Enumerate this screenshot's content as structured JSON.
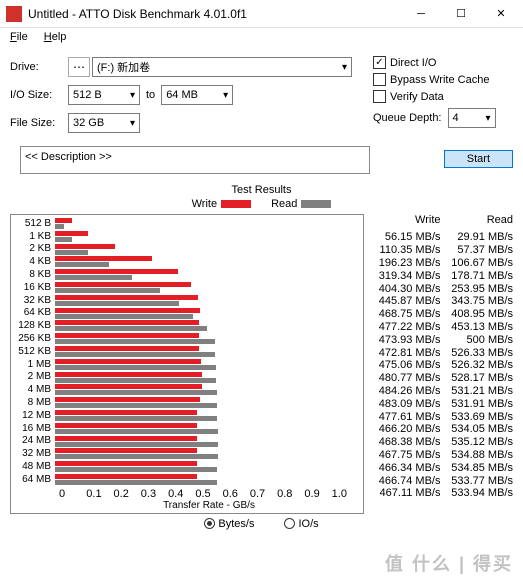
{
  "window": {
    "title": "Untitled - ATTO Disk Benchmark 4.01.0f1"
  },
  "menu": {
    "file": "File",
    "help": "Help"
  },
  "form": {
    "drive_label": "Drive:",
    "drive_value": "(F:) 新加卷",
    "io_label": "I/O Size:",
    "io_from": "512 B",
    "to": "to",
    "io_to": "64 MB",
    "fs_label": "File Size:",
    "fs_value": "32 GB",
    "direct_io": "Direct I/O",
    "bypass": "Bypass Write Cache",
    "verify": "Verify Data",
    "qd_label": "Queue Depth:",
    "qd_value": "4",
    "start": "Start",
    "description": "<< Description >>"
  },
  "results": {
    "title": "Test Results",
    "write": "Write",
    "read": "Read",
    "axis_label": "Transfer Rate - GB/s",
    "ticks": [
      "0",
      "0.1",
      "0.2",
      "0.3",
      "0.4",
      "0.5",
      "0.6",
      "0.7",
      "0.8",
      "0.9",
      "1.0"
    ],
    "bytes_s": "Bytes/s",
    "io_s": "IO/s"
  },
  "chart_data": {
    "type": "bar",
    "xlabel": "Transfer Rate - GB/s",
    "xlim": [
      0,
      1.0
    ],
    "categories": [
      "512 B",
      "1 KB",
      "2 KB",
      "4 KB",
      "8 KB",
      "16 KB",
      "32 KB",
      "64 KB",
      "128 KB",
      "256 KB",
      "512 KB",
      "1 MB",
      "2 MB",
      "4 MB",
      "8 MB",
      "12 MB",
      "16 MB",
      "24 MB",
      "32 MB",
      "48 MB",
      "64 MB"
    ],
    "series": [
      {
        "name": "Write",
        "color": "#e41e26",
        "values": [
          56.15,
          110.35,
          196.23,
          319.34,
          404.3,
          445.87,
          468.75,
          477.22,
          473.93,
          472.81,
          475.06,
          480.77,
          484.26,
          483.09,
          477.61,
          466.2,
          468.38,
          467.75,
          466.34,
          466.74,
          467.11
        ]
      },
      {
        "name": "Read",
        "color": "#808080",
        "values": [
          29.91,
          57.37,
          106.67,
          178.71,
          253.95,
          343.75,
          408.95,
          453.13,
          500,
          526.33,
          526.32,
          528.17,
          531.21,
          531.91,
          533.69,
          534.05,
          535.12,
          534.88,
          534.85,
          533.77,
          533.94
        ]
      }
    ],
    "unit": "MB/s",
    "scale_to_gb": 1000
  },
  "watermark": "值   什么 | 得买"
}
